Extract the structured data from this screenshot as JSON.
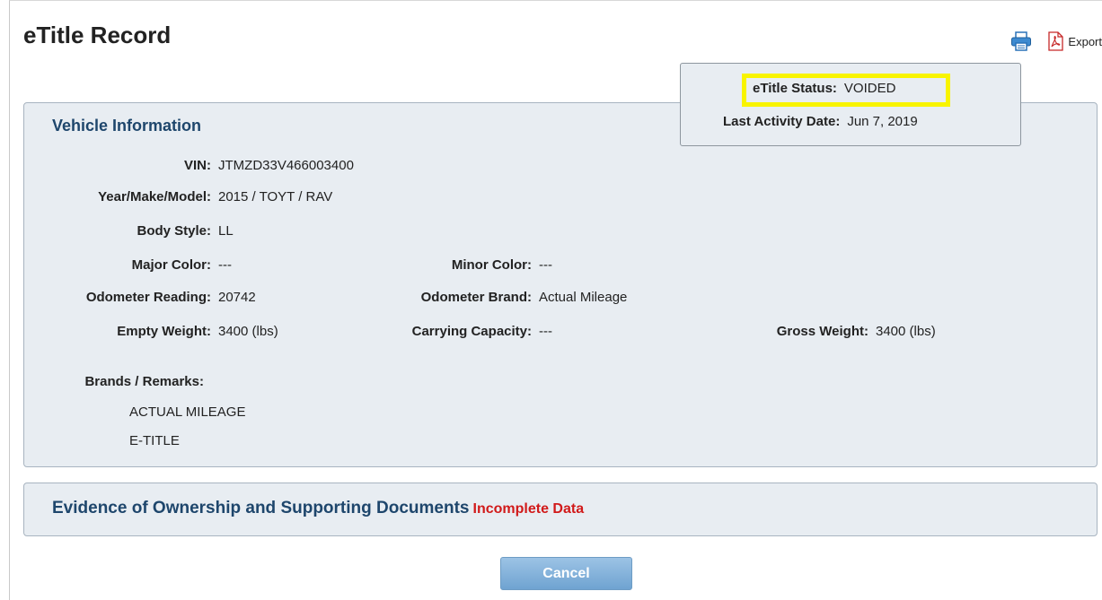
{
  "page": {
    "title": "eTitle Record"
  },
  "toolbar": {
    "print_icon": "printer-icon",
    "pdf_icon": "pdf-icon",
    "export_label": "Export"
  },
  "status": {
    "status_label": "eTitle Status:",
    "status_value": "VOIDED",
    "highlight_color": "#f8f400",
    "date_label": "Last Activity Date:",
    "date_value": "Jun 7, 2019"
  },
  "vehicle": {
    "title": "Vehicle Information",
    "vin": {
      "label": "VIN:",
      "value": "JTMZD33V466003400"
    },
    "ymm": {
      "label": "Year/Make/Model:",
      "value": "2015 / TOYT / RAV"
    },
    "body_style": {
      "label": "Body Style:",
      "value": "LL"
    },
    "major_color": {
      "label": "Major Color:",
      "value": "---"
    },
    "minor_color": {
      "label": "Minor Color:",
      "value": "---"
    },
    "odometer_reading": {
      "label": "Odometer Reading:",
      "value": "20742"
    },
    "odometer_brand": {
      "label": "Odometer Brand:",
      "value": "Actual Mileage"
    },
    "empty_weight": {
      "label": "Empty Weight:",
      "value": "3400 (lbs)"
    },
    "carrying_capacity": {
      "label": "Carrying Capacity:",
      "value": "---"
    },
    "gross_weight": {
      "label": "Gross Weight:",
      "value": "3400 (lbs)"
    },
    "remarks_label": "Brands / Remarks:",
    "remarks": [
      "ACTUAL MILEAGE",
      "E-TITLE"
    ]
  },
  "evidence": {
    "title": "Evidence of Ownership and Supporting Documents",
    "flag": "Incomplete Data",
    "flag_color": "#d11a1a"
  },
  "actions": {
    "cancel_label": "Cancel"
  }
}
